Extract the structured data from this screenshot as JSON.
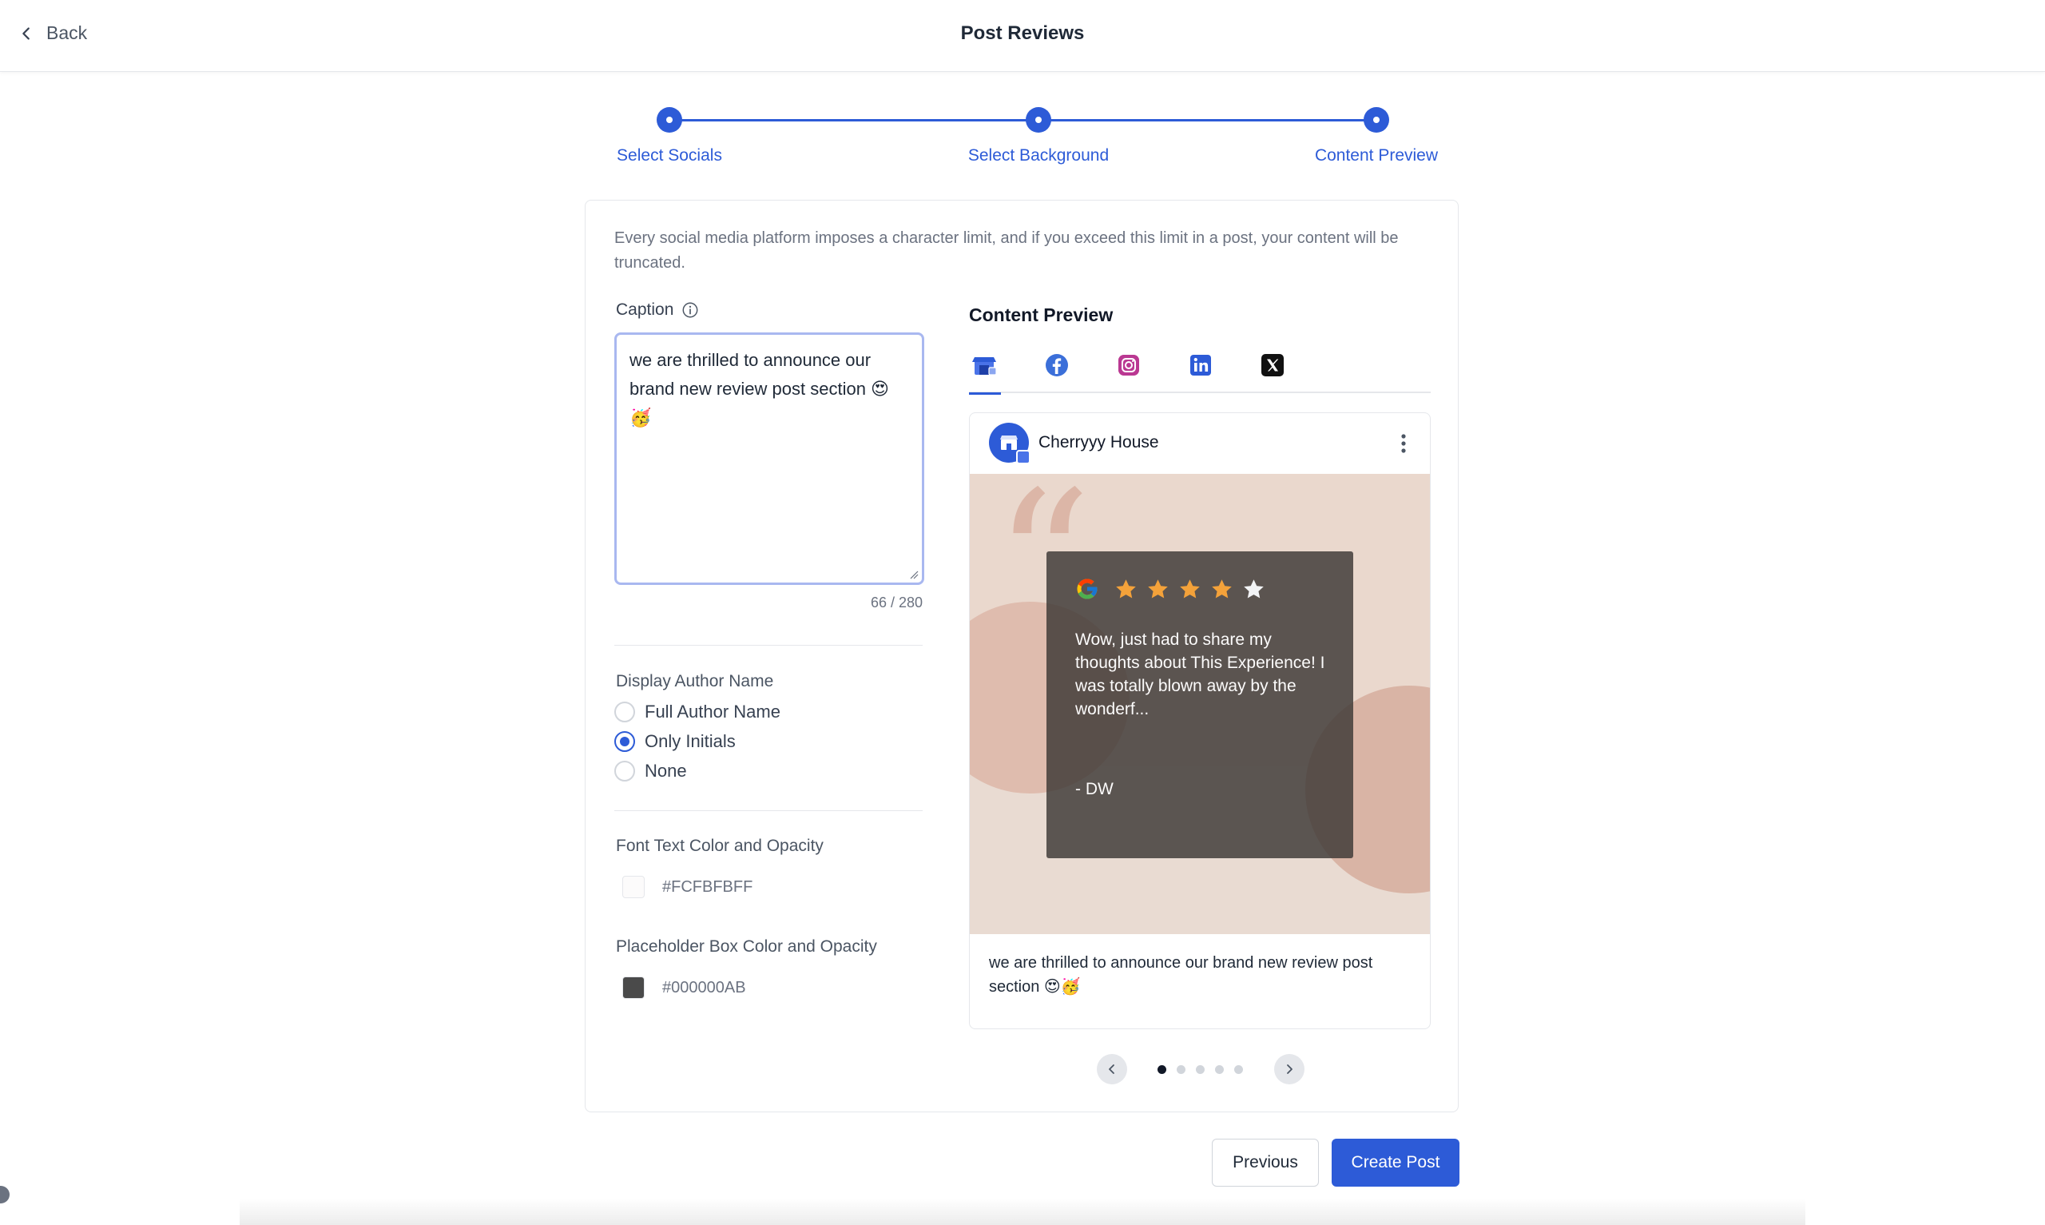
{
  "header": {
    "back_label": "Back",
    "title": "Post Reviews"
  },
  "stepper": {
    "steps": [
      {
        "label": "Select Socials"
      },
      {
        "label": "Select Background"
      },
      {
        "label": "Content Preview"
      }
    ]
  },
  "notice": "Every social media platform imposes a character limit, and if you exceed this limit in a post, your content will be truncated.",
  "caption": {
    "label": "Caption",
    "value": "we are thrilled to announce our brand new review post section 😍🥳",
    "count": "66 / 280"
  },
  "author_display": {
    "label": "Display Author Name",
    "options": [
      {
        "label": "Full Author Name",
        "checked": false
      },
      {
        "label": "Only Initials",
        "checked": true
      },
      {
        "label": "None",
        "checked": false
      }
    ]
  },
  "font_color": {
    "label": "Font Text Color and Opacity",
    "value": "#FCFBFBFF",
    "swatch": "#FCFBFB"
  },
  "box_color": {
    "label": "Placeholder Box Color and Opacity",
    "value": "#000000AB",
    "swatch": "#4a4a4a"
  },
  "preview": {
    "title": "Content Preview",
    "tabs": [
      "google-business-icon",
      "facebook-icon",
      "instagram-icon",
      "linkedin-icon",
      "x-icon"
    ],
    "active_tab": 0,
    "account_name": "Cherryyy House",
    "review": {
      "rating": 5,
      "filled_stars": 4,
      "text": "Wow, just had to share my thoughts about This Experience! I was totally blown away by the wonderf...",
      "author": "- DW"
    },
    "caption": "we are thrilled to announce our brand new review post section 😍🥳",
    "pages": 5,
    "current_page": 1
  },
  "actions": {
    "previous": "Previous",
    "create": "Create Post"
  },
  "colors": {
    "accent": "#2D5BD7",
    "star": "#F4A23A"
  }
}
